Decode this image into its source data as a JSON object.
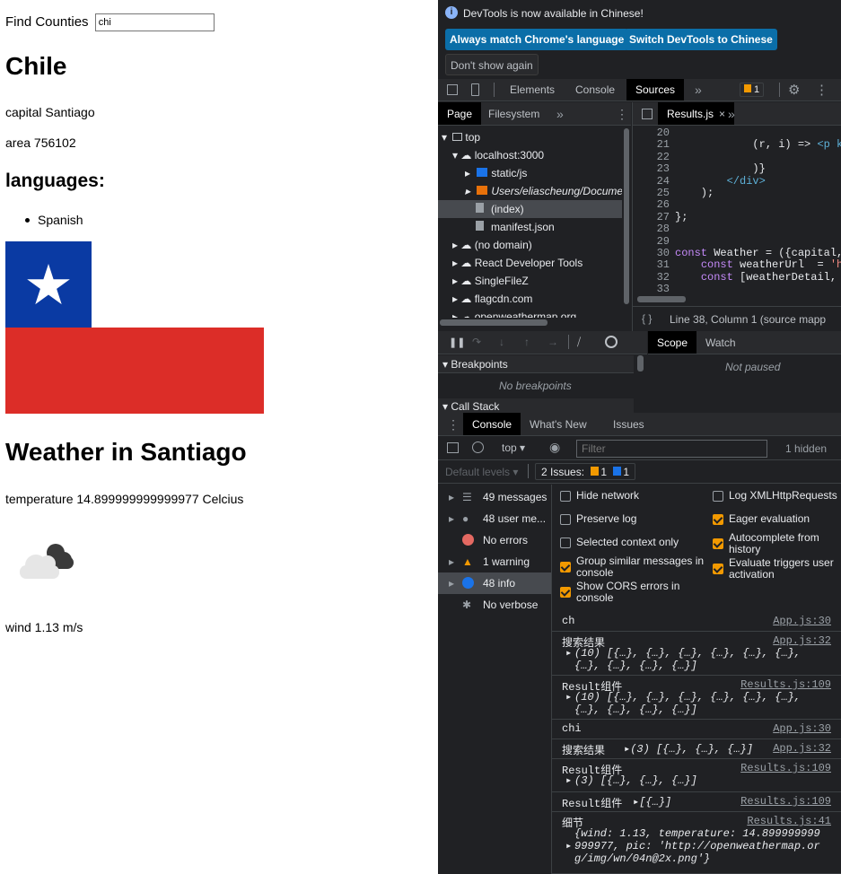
{
  "app": {
    "find_label": "Find Counties",
    "search_value": "chi",
    "country_name": "Chile",
    "capital_line": "capital Santiago",
    "area_line": "area 756102",
    "languages_heading": "languages:",
    "languages": [
      "Spanish"
    ],
    "weather_heading": "Weather in Santiago",
    "temperature_line": "temperature 14.899999999999977 Celcius",
    "wind_line": "wind 1.13 m/s",
    "flag_colors": {
      "blue": "#0039a6",
      "white": "#ffffff",
      "red": "#d52b1e"
    }
  },
  "devtools": {
    "banner_text": "DevTools is now available in Chinese!",
    "btn_match": "Always match Chrome's language",
    "btn_switch": "Switch DevTools to Chinese",
    "btn_dont_show": "Don't show again",
    "tabs": [
      "Elements",
      "Console",
      "Sources"
    ],
    "issues_badge": "1",
    "nav_tabs": [
      "Page",
      "Filesystem"
    ],
    "file_tab": "Results.js",
    "tree": [
      "top",
      "localhost:3000",
      "static/js",
      "Users/eliascheung/Docume",
      "(index)",
      "manifest.json",
      "(no domain)",
      "React Developer Tools",
      "SingleFileZ",
      "flagcdn.com",
      "openweathermap.org"
    ],
    "code_lines": [
      {
        "n": "20",
        "t": ""
      },
      {
        "n": "21",
        "t": "            (r, i) => <p k"
      },
      {
        "n": "22",
        "t": ""
      },
      {
        "n": "23",
        "t": "            )}"
      },
      {
        "n": "24",
        "t": "        </div>"
      },
      {
        "n": "25",
        "t": "    );"
      },
      {
        "n": "26",
        "t": ""
      },
      {
        "n": "27",
        "t": "};"
      },
      {
        "n": "28",
        "t": ""
      },
      {
        "n": "29",
        "t": ""
      },
      {
        "n": "30",
        "t": "const Weather = ({capital,"
      },
      {
        "n": "31",
        "t": "    const weatherUrl  = 'h"
      },
      {
        "n": "32",
        "t": "    const [weatherDetail,"
      },
      {
        "n": "33",
        "t": ""
      }
    ],
    "status_line": "Line 38, Column 1  (source mapp",
    "scope_tab": "Scope",
    "watch_tab": "Watch",
    "not_paused": "Not paused",
    "breakpoints": "Breakpoints",
    "no_breakpoints": "No breakpoints",
    "call_stack": "Call Stack",
    "drawer_tabs": [
      "Console",
      "What's New",
      "Issues"
    ],
    "context": "top",
    "filter_placeholder": "Filter",
    "hidden": "1 hidden",
    "default_levels": "Default levels",
    "issues_count_label": "2 Issues:",
    "issue_warn": "1",
    "issue_info": "1",
    "sidebar": [
      "49 messages",
      "48 user me...",
      "No errors",
      "1 warning",
      "48 info",
      "No verbose"
    ],
    "options_left": [
      "Hide network",
      "Preserve log",
      "Selected context only",
      "Group similar messages in console",
      "Show CORS errors in console"
    ],
    "options_right": [
      "Log XMLHttpRequests",
      "Eager evaluation",
      "Autocomplete from history",
      "Evaluate triggers user activation"
    ],
    "logs": [
      {
        "msg": "ch",
        "src": "App.js:30"
      },
      {
        "msg": "搜索结果",
        "src": "App.js:32",
        "detail": "(10) [{…}, {…}, {…}, {…}, {…}, {…}, {…}, {…}, {…}, {…}]"
      },
      {
        "msg": "Result组件",
        "src": "Results.js:109",
        "detail": "(10) [{…}, {…}, {…}, {…}, {…}, {…}, {…}, {…}, {…}, {…}]"
      },
      {
        "msg": "chi",
        "src": "App.js:30"
      },
      {
        "msg": "搜索结果",
        "src": "App.js:32",
        "detail": "(3) [{…}, {…}, {…}]"
      },
      {
        "msg": "Result组件",
        "src": "Results.js:109",
        "detail": "(3) [{…}, {…}, {…}]"
      },
      {
        "msg": "Result组件",
        "src": "Results.js:109",
        "detail": "[{…}]"
      },
      {
        "msg": "细节",
        "src": "Results.js:41",
        "detail": "{wind: 1.13, temperature: 14.899999999999977, pic: 'http://openweathermap.org/img/wn/04n@2x.png'}"
      }
    ]
  }
}
